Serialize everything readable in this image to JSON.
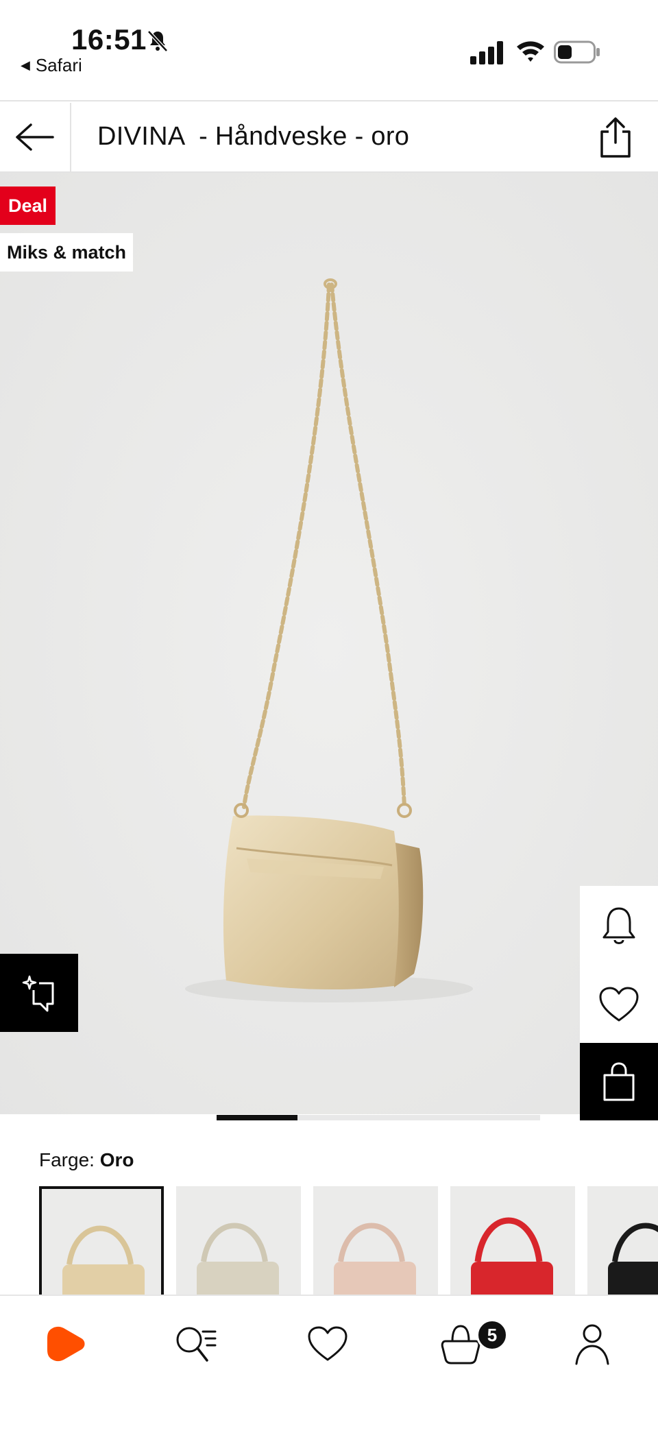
{
  "status_bar": {
    "time": "16:51",
    "back_app_label": "Safari",
    "battery_level_percent": 35
  },
  "header": {
    "title": "DIVINA  - Håndveske - oro"
  },
  "product": {
    "badges": [
      "Deal",
      "Miks & match"
    ],
    "badge_deal_color": "#e3001b",
    "image_carousel_progress_fraction": 0.25
  },
  "color_selector": {
    "label": "Farge: ",
    "selected_value": "Oro",
    "swatches": [
      {
        "name": "oro",
        "color": "#e2cfa6",
        "selected": true
      },
      {
        "name": "beige",
        "color": "#d8d2c0",
        "selected": false
      },
      {
        "name": "rose",
        "color": "#e6c8b8",
        "selected": false
      },
      {
        "name": "red",
        "color": "#d8262c",
        "selected": false
      },
      {
        "name": "black",
        "color": "#1a1a1a",
        "selected": false
      }
    ]
  },
  "bottom_nav": {
    "items": [
      "home-icon",
      "search-icon",
      "heart-icon",
      "cart-icon",
      "profile-icon"
    ],
    "cart_count": "5",
    "accent": "#ff4f00"
  }
}
